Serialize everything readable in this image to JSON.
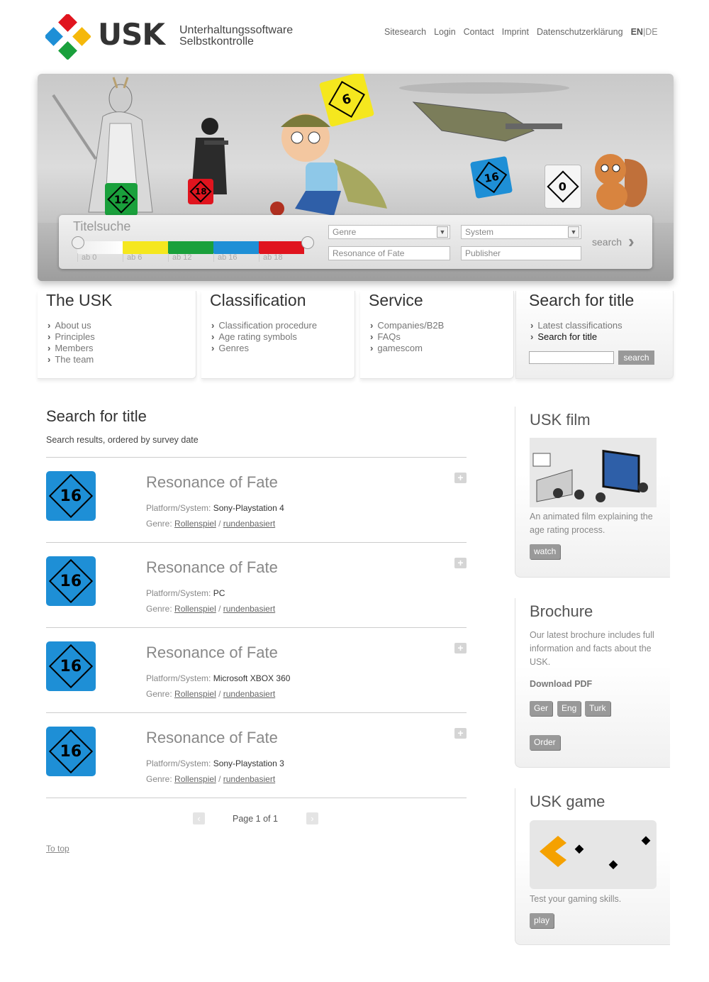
{
  "header": {
    "logo_text": "USK",
    "logo_sub_1": "Unterhaltungssoftware",
    "logo_sub_2": "Selbstkontrolle",
    "nav": [
      "Sitesearch",
      "Login",
      "Contact",
      "Imprint",
      "Datenschutzerklärung"
    ],
    "lang_en": "EN",
    "lang_sep": "|",
    "lang_de": "DE"
  },
  "banner": {
    "title": "Titelsuche",
    "age_labels": [
      "ab 0",
      "ab 6",
      "ab 12",
      "ab 16",
      "ab 18"
    ],
    "age_colors": [
      "#ffffff",
      "#f5e71e",
      "#1aa03c",
      "#1e8fd6",
      "#e0141e"
    ],
    "genre_placeholder": "Genre",
    "system_placeholder": "System",
    "title_value": "Resonance of Fate",
    "publisher_placeholder": "Publisher",
    "search_label": "search",
    "badges": [
      "12",
      "18",
      "6",
      "16",
      "0"
    ]
  },
  "nav_boxes": [
    {
      "title": "The USK",
      "items": [
        "About us",
        "Principles",
        "Members",
        "The team"
      ]
    },
    {
      "title": "Classification",
      "items": [
        "Classification procedure",
        "Age rating symbols",
        "Genres"
      ]
    },
    {
      "title": "Service",
      "items": [
        "Companies/B2B",
        "FAQs",
        "gamescom"
      ]
    },
    {
      "title": "Search for title",
      "items": [
        "Latest classifications",
        "Search for title"
      ],
      "search_button": "search"
    }
  ],
  "main": {
    "heading": "Search for title",
    "subheading": "Search results, ordered by survey date",
    "platform_label": "Platform/System:",
    "genre_label": "Genre:",
    "genre_sep": "/",
    "results": [
      {
        "title": "Resonance of Fate",
        "rating": "16",
        "platform": "Sony-Playstation 4",
        "genre1": "Rollenspiel",
        "genre2": "rundenbasiert"
      },
      {
        "title": "Resonance of Fate",
        "rating": "16",
        "platform": "PC",
        "genre1": "Rollenspiel",
        "genre2": "rundenbasiert"
      },
      {
        "title": "Resonance of Fate",
        "rating": "16",
        "platform": "Microsoft XBOX 360",
        "genre1": "Rollenspiel",
        "genre2": "rundenbasiert"
      },
      {
        "title": "Resonance of Fate",
        "rating": "16",
        "platform": "Sony-Playstation 3",
        "genre1": "Rollenspiel",
        "genre2": "rundenbasiert"
      }
    ],
    "pager": "Page 1 of 1",
    "to_top": "To top"
  },
  "sidebar": {
    "film": {
      "title": "USK film",
      "text": "An animated film explaining the age rating process.",
      "button": "watch"
    },
    "brochure": {
      "title": "Brochure",
      "text": "Our latest brochure includes full information and facts about the USK.",
      "download": "Download PDF",
      "langs": [
        "Ger",
        "Eng",
        "Turk"
      ],
      "order": "Order"
    },
    "game": {
      "title": "USK game",
      "text": "Test your gaming skills.",
      "button": "play"
    }
  }
}
